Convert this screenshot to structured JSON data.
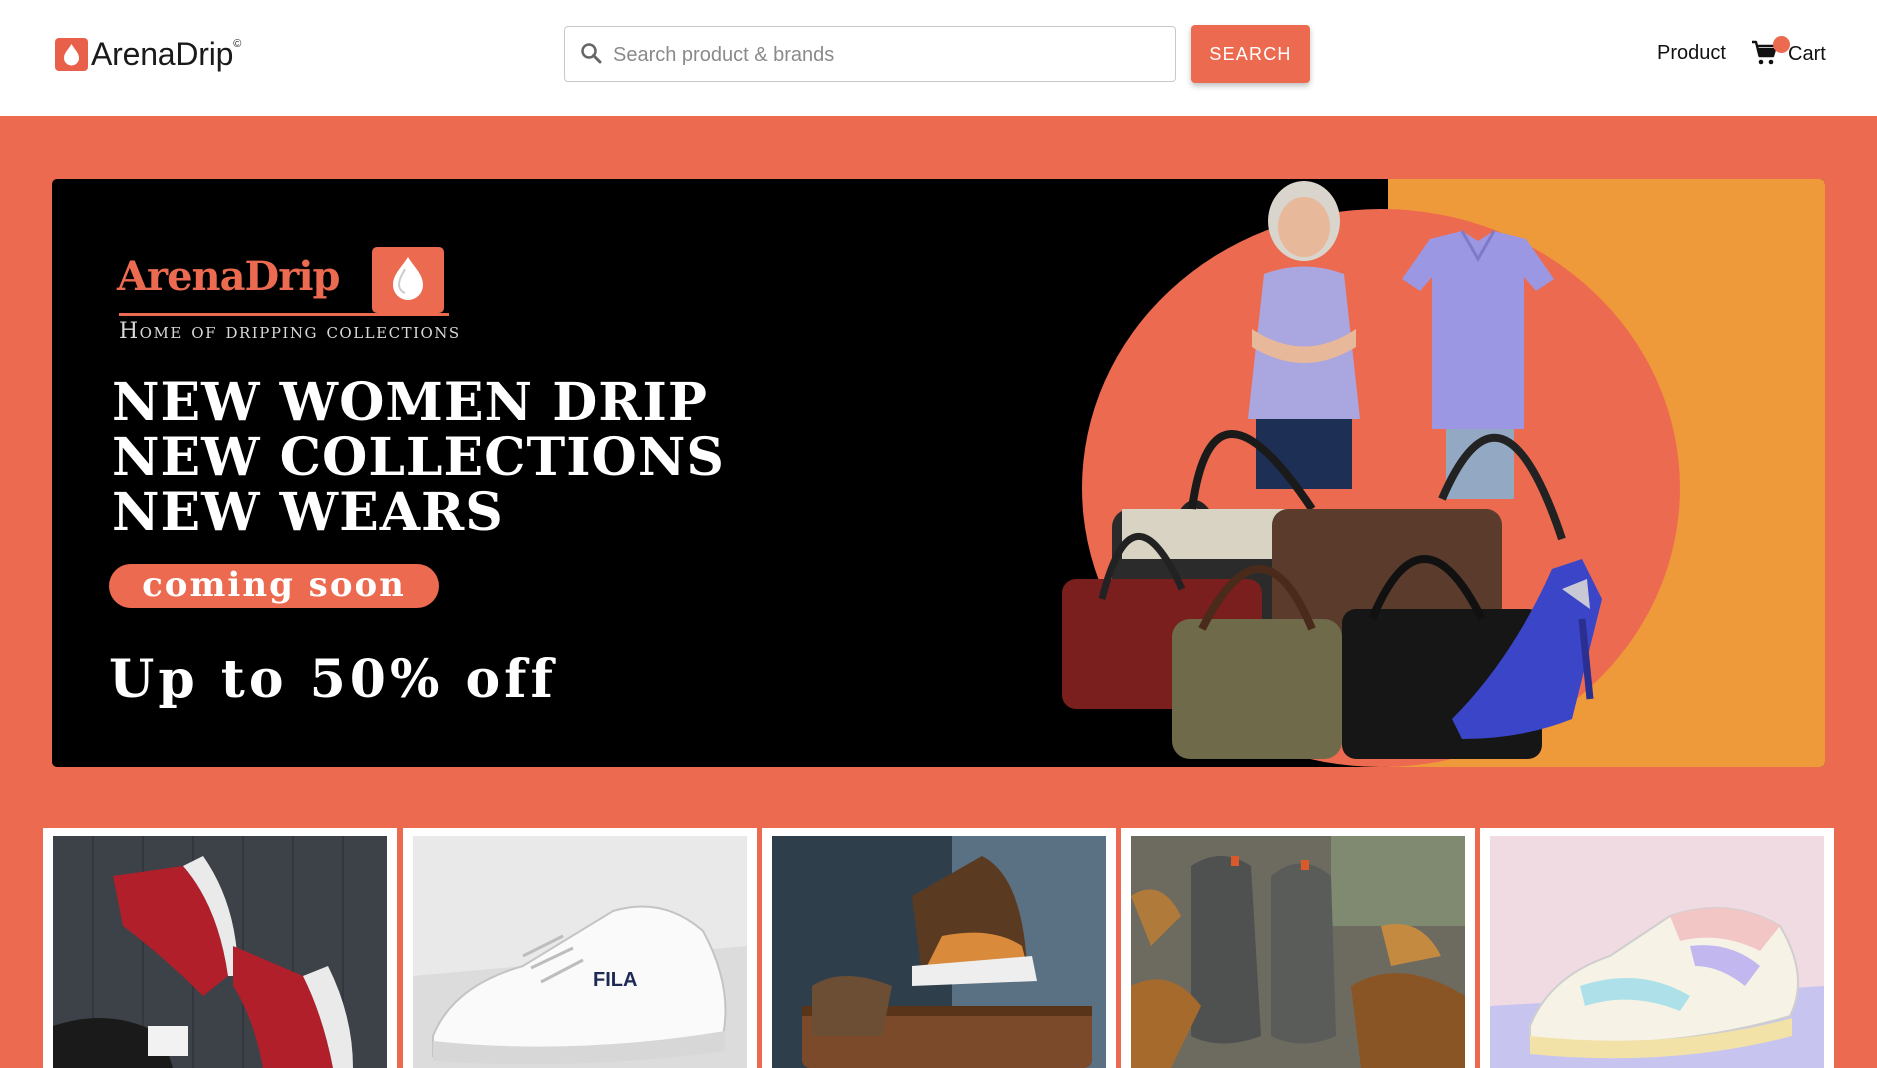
{
  "header": {
    "logo_text": "ArenaDrip",
    "logo_reg": "©",
    "search_placeholder": "Search product & brands",
    "search_button": "SEARCH",
    "nav_product": "Product",
    "cart_label": "Cart"
  },
  "banner": {
    "brand_name": "ArenaDrip",
    "tagline": "Home of dripping collections",
    "headline_lines": [
      "NEW WOMEN DRIP",
      "NEW COLLECTIONS",
      "NEW WEARS"
    ],
    "badge": "coming soon",
    "discount": "Up to 50% off"
  },
  "products": [
    {
      "icon": "red-high-top-sneakers-image"
    },
    {
      "icon": "white-fila-sneaker-image"
    },
    {
      "icon": "louis-vuitton-sneaker-image"
    },
    {
      "icon": "gray-boots-in-leaves-image"
    },
    {
      "icon": "pastel-sneaker-image"
    }
  ],
  "colors": {
    "accent": "#EC6B50",
    "banner_orange": "#EF9A3A",
    "banner_bg": "#000000",
    "header_bg": "#FFFFFF"
  }
}
